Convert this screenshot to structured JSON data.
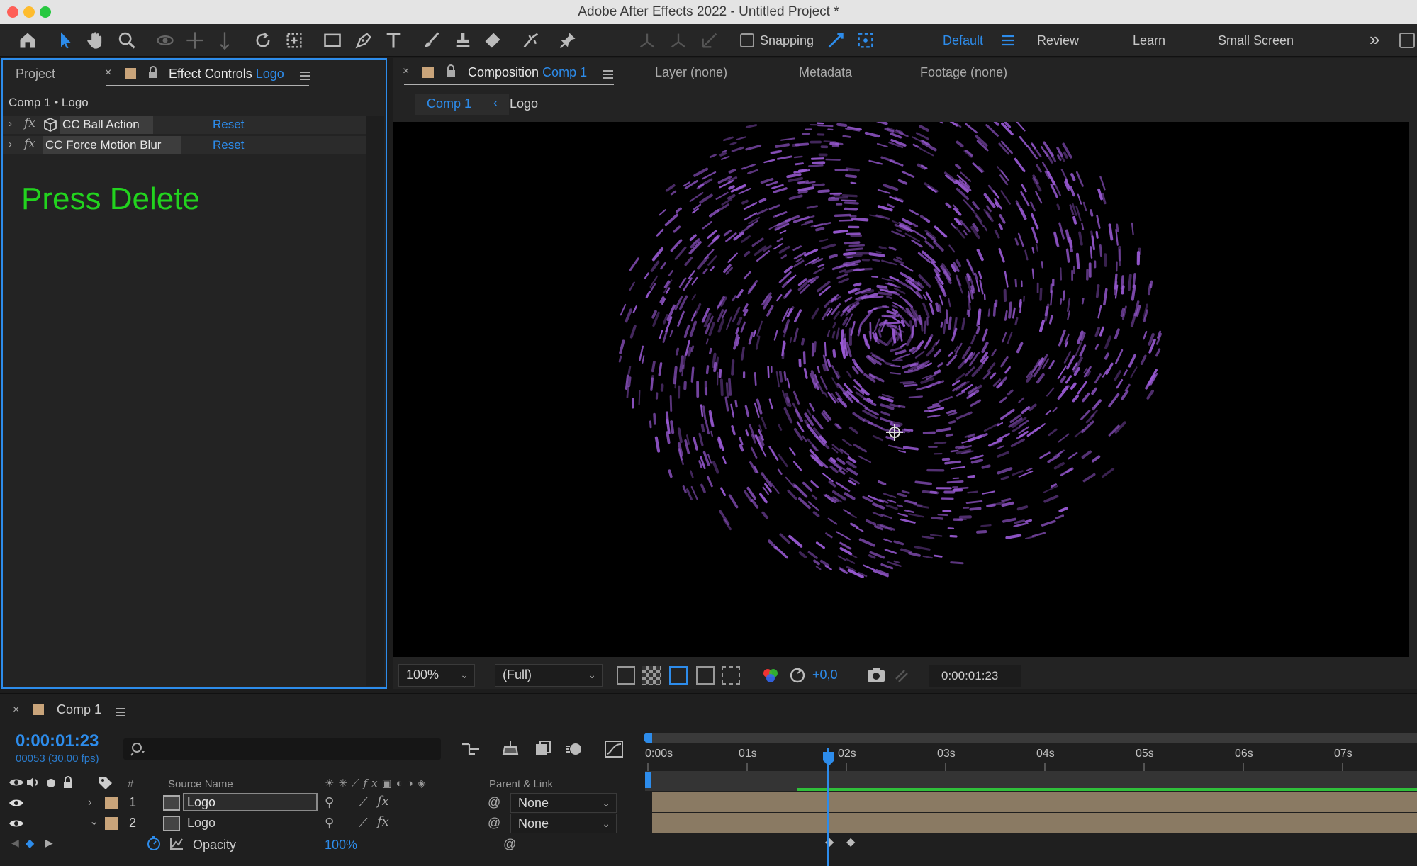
{
  "window": {
    "title": "Adobe After Effects 2022 - Untitled Project *"
  },
  "toolbar": {
    "snapping_label": "Snapping",
    "workspaces": [
      "Default",
      "Review",
      "Learn",
      "Small Screen"
    ],
    "more": "»"
  },
  "left_panel": {
    "project_tab": "Project",
    "effect_controls_tab": "Effect Controls",
    "effect_controls_layer": "Logo",
    "breadcrumb": "Comp 1 • Logo",
    "effects": [
      {
        "name": "CC Ball Action",
        "reset": "Reset"
      },
      {
        "name": "CC Force Motion Blur",
        "reset": "Reset"
      }
    ],
    "instruction": "Press Delete"
  },
  "comp_panel": {
    "composition_tab": "Composition",
    "composition_name": "Comp 1",
    "layer_tab": "Layer (none)",
    "metadata_tab": "Metadata",
    "footage_tab": "Footage (none)",
    "nav_comp": "Comp 1",
    "nav_layer": "Logo",
    "zoom": "100%",
    "resolution": "(Full)",
    "exposure": "+0,0",
    "timecode": "0:00:01:23"
  },
  "timeline": {
    "tab": "Comp 1",
    "timecode": "0:00:01:23",
    "frame_info": "00053 (30.00 fps)",
    "headers": {
      "number": "#",
      "source_name": "Source Name",
      "parent_link": "Parent & Link"
    },
    "layers": [
      {
        "num": "1",
        "name": "Logo",
        "parent": "None"
      },
      {
        "num": "2",
        "name": "Logo",
        "parent": "None"
      }
    ],
    "property": {
      "name": "Opacity",
      "value": "100%"
    },
    "ruler": [
      "0:00s",
      "01s",
      "02s",
      "03s",
      "04s",
      "05s",
      "06s",
      "07s"
    ]
  },
  "colors": {
    "accent": "#2d8ceb",
    "instruction": "#22d31e",
    "track": "#8a7a63",
    "particle": "#9b5bd6",
    "green_bar": "#2fbf3a"
  }
}
